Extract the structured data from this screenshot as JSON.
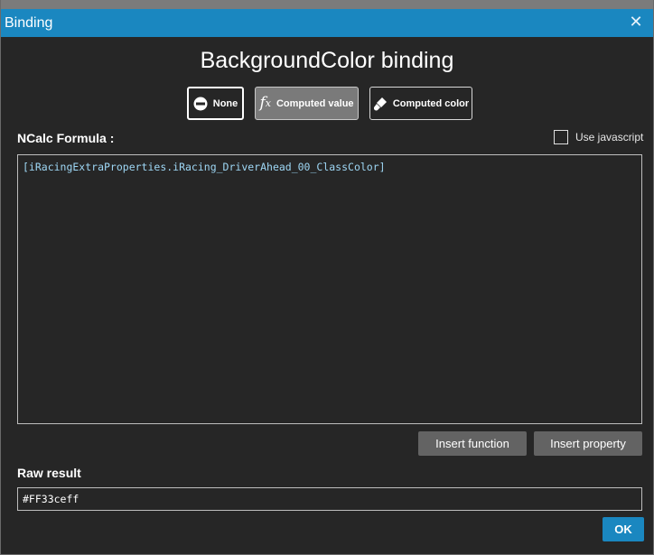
{
  "window": {
    "title": "Binding",
    "close_icon": "close-icon"
  },
  "heading": "BackgroundColor binding",
  "modes": {
    "none_label": "None",
    "computed_value_label": "Computed value",
    "computed_color_label": "Computed color",
    "selected": "Computed value"
  },
  "formula": {
    "label": "NCalc Formula :",
    "use_javascript_label": "Use javascript",
    "use_javascript_checked": false,
    "text": "[iRacingExtraProperties.iRacing_DriverAhead_00_ClassColor]"
  },
  "actions": {
    "insert_function": "Insert function",
    "insert_property": "Insert property"
  },
  "raw_result": {
    "label": "Raw result",
    "value": "#FF33ceff"
  },
  "ok_label": "OK",
  "colors": {
    "titlebar": "#1a87c0",
    "background": "#262626",
    "formula_text": "#9ed7f5",
    "button": "#636363",
    "selected_mode": "#7a7a7a"
  }
}
